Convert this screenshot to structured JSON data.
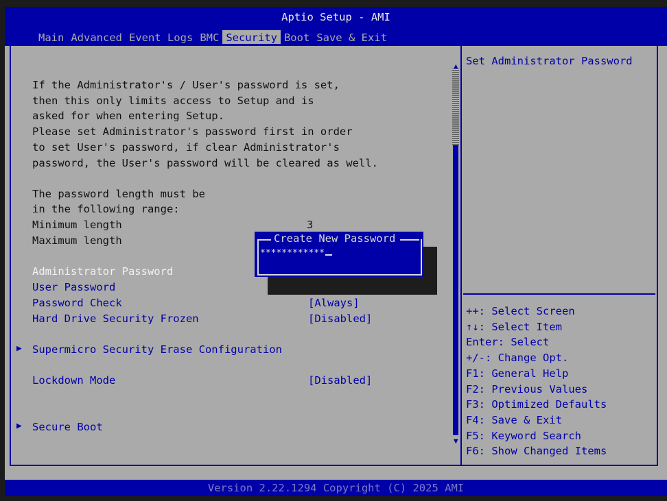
{
  "header": {
    "title": "Aptio Setup - AMI",
    "tabs": [
      "Main",
      "Advanced",
      "Event Logs",
      "BMC",
      "Security",
      "Boot",
      "Save & Exit"
    ],
    "active_tab": "Security"
  },
  "main": {
    "description": [
      "If the Administrator's / User's password is set,",
      "then this only limits access to Setup and is",
      "asked for when entering Setup.",
      "Please set Administrator's password first in order",
      "to set User's password, if clear Administrator's",
      "password, the User's password will be cleared as well."
    ],
    "length_info": [
      "The password length must be",
      "in the following range:"
    ],
    "min_label": "Minimum length",
    "min_value": "3",
    "max_label": "Maximum length",
    "items": {
      "admin_password": "Administrator Password",
      "user_password": "User Password",
      "password_check": {
        "label": "Password Check",
        "value": "[Always]"
      },
      "hdd_frozen": {
        "label": "Hard Drive Security Frozen",
        "value": "[Disabled]"
      },
      "erase_config": "Supermicro Security Erase Configuration",
      "lockdown": {
        "label": "Lockdown Mode",
        "value": "[Disabled]"
      },
      "secure_boot": "Secure Boot"
    }
  },
  "dialog": {
    "title": "Create New Password",
    "value": "************"
  },
  "help": {
    "text": "Set Administrator Password",
    "keys": [
      {
        "key": "++:",
        "desc": "Select Screen"
      },
      {
        "key": "↑↓:",
        "desc": "Select Item"
      },
      {
        "key": "Enter:",
        "desc": "Select"
      },
      {
        "key": "+/-:",
        "desc": "Change Opt."
      },
      {
        "key": "F1:",
        "desc": "General Help"
      },
      {
        "key": "F2:",
        "desc": "Previous Values"
      },
      {
        "key": "F3:",
        "desc": "Optimized Defaults"
      },
      {
        "key": "F4:",
        "desc": "Save & Exit"
      },
      {
        "key": "F5:",
        "desc": "Keyword Search"
      },
      {
        "key": "F6:",
        "desc": "Show Changed Items"
      }
    ]
  },
  "footer": {
    "version": "Version 2.22.1294 Copyright (C) 2025 AMI"
  },
  "colors": {
    "bios_blue": "#0000a8",
    "bios_gray": "#aaaaaa",
    "highlight": "#f2f2f2"
  }
}
